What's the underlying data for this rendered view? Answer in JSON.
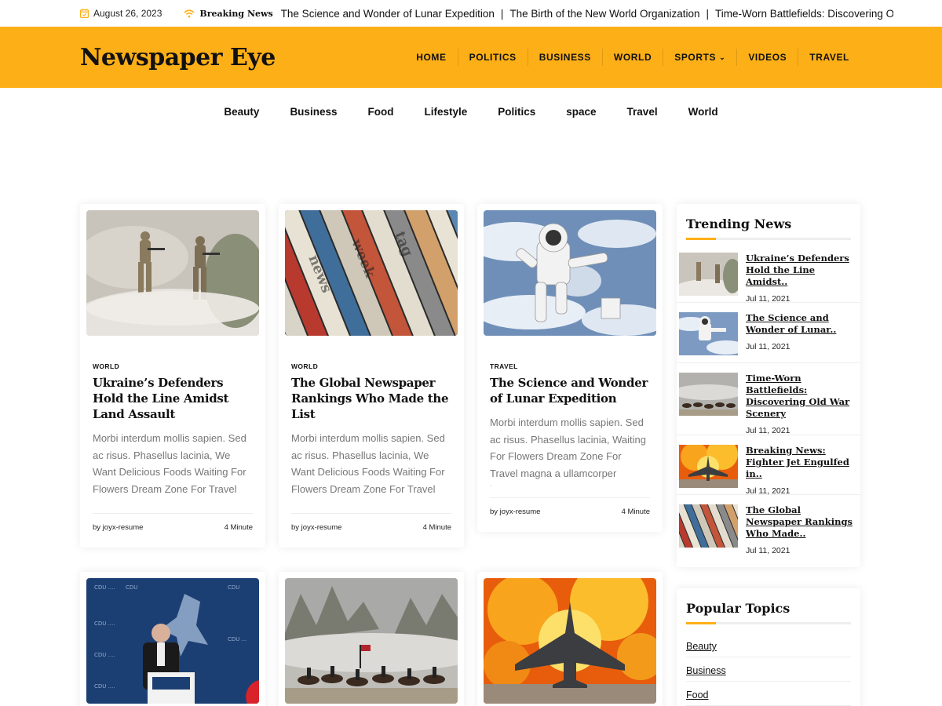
{
  "topbar": {
    "date": "August 26, 2023",
    "breaking_label": "Breaking News",
    "ticker": [
      "The Science and Wonder of Lunar Expedition",
      "The Birth of the New World Organization",
      "Time-Worn Battlefields: Discovering Old War Scene"
    ],
    "ticker_sep": "|"
  },
  "header": {
    "logo": "Newspaper Eye",
    "nav": [
      "HOME",
      "POLITICS",
      "BUSINESS",
      "WORLD",
      "SPORTS",
      "VIDEOS",
      "TRAVEL"
    ]
  },
  "categories": [
    "Beauty",
    "Business",
    "Food",
    "Lifestyle",
    "Politics",
    "space",
    "Travel",
    "World"
  ],
  "cards": [
    {
      "category": "WORLD",
      "title": "Ukraine’s Defenders Hold the Line Amidst Land Assault",
      "excerpt": "Morbi interdum mollis sapien. Sed ac risus. Phasellus lacinia, We Want Delicious Foods Waiting For Flowers Dream Zone For Travel",
      "author": "by joyx-resume",
      "read_time": "4 Minute",
      "image": "soldiers-in-smoke"
    },
    {
      "category": "WORLD",
      "title": "The Global Newspaper Rankings Who Made the List",
      "excerpt": "Morbi interdum mollis sapien. Sed ac risus. Phasellus lacinia, We Want Delicious Foods Waiting For Flowers Dream Zone For Travel",
      "author": "by joyx-resume",
      "read_time": "4 Minute",
      "image": "rolled-newspapers"
    },
    {
      "category": "TRAVEL",
      "title": "The Science and Wonder of Lunar Expedition",
      "excerpt": "Morbi interdum mollis sapien. Sed ac risus. Phasellus lacinia, Waiting For Flowers Dream Zone For Travel magna a ullamcorper laoreet,",
      "author": "by joyx-resume",
      "read_time": "4 Minute",
      "image": "astronaut-space"
    }
  ],
  "second_row_images": [
    "politician-speech",
    "cavalry-battle",
    "fighter-jet-fire"
  ],
  "sidebar": {
    "trending_title": "Trending News",
    "trending": [
      {
        "title": "Ukraine’s Defenders Hold the Line Amidst..",
        "date": "Jul 11, 2021",
        "image": "soldiers-in-smoke"
      },
      {
        "title": "The Science and Wonder of Lunar..",
        "date": "Jul 11, 2021",
        "image": "astronaut-space"
      },
      {
        "title": "Time-Worn Battlefields: Discovering Old War Scenery",
        "date": "Jul 11, 2021",
        "image": "cavalry-battle"
      },
      {
        "title": "Breaking News: Fighter Jet Engulfed in..",
        "date": "Jul 11, 2021",
        "image": "fighter-jet-fire"
      },
      {
        "title": "The Global Newspaper Rankings Who Made..",
        "date": "Jul 11, 2021",
        "image": "rolled-newspapers"
      }
    ],
    "popular_title": "Popular Topics",
    "popular": [
      "Beauty",
      "Business",
      "Food"
    ]
  },
  "colors": {
    "accent": "#fdaf17",
    "text": "#111111",
    "muted": "#777777"
  }
}
